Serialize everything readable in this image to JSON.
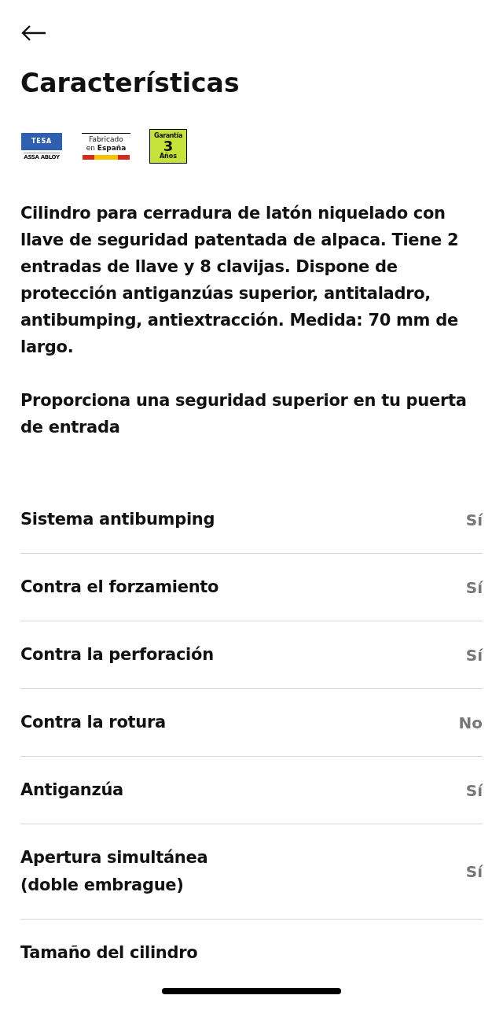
{
  "title": "Características",
  "badges": [
    {
      "kind": "tesa",
      "brand": "TESA",
      "maker": "ASSA ABLOY"
    },
    {
      "kind": "made_in",
      "line1": "Fabricado",
      "line2_prefix": "en",
      "line2": "España"
    },
    {
      "kind": "warranty",
      "top": "Garantía",
      "number": "3",
      "bottom": "Años"
    }
  ],
  "paragraphs": [
    "Cilindro para cerradura de latón niquelado con llave de seguridad patentada de alpaca. Tiene 2 entradas de llave y 8 clavijas. Dispone de protección antiganzúas superior, antitaladro, antibumping, antiextracción. Medida: 70 mm de largo.",
    "Proporciona una seguridad superior en tu puerta de entrada"
  ],
  "features": [
    {
      "label": "Sistema antibumping",
      "value": "Sí"
    },
    {
      "label": "Contra el forzamiento",
      "value": "Sí"
    },
    {
      "label": "Contra la perforación",
      "value": "Sí"
    },
    {
      "label": "Contra la rotura",
      "value": "No"
    },
    {
      "label": "Antiganzúa",
      "value": "Sí"
    },
    {
      "label": "Apertura simultánea\n(doble embrague)",
      "value": "Sí"
    },
    {
      "label": "Tamaño del cilindro"
    }
  ]
}
